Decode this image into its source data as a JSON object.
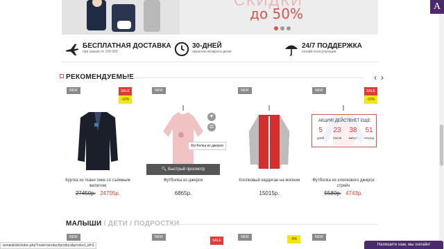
{
  "hero": {
    "headline_top": "СКИДКИ",
    "headline": "до 50%",
    "slide_count": 3,
    "active_slide": 1
  },
  "logo_letter": "A",
  "features": [
    {
      "icon": "airplane-icon",
      "title": "БЕСПЛАТНАЯ ДОСТАВКА",
      "subtitle": "при заказе от 100 000"
    },
    {
      "icon": "clock-icon",
      "title": "30-ДНЕЙ",
      "subtitle": "гарантия возврата денег"
    },
    {
      "icon": "umbrella-icon",
      "title": "24/7 ПОДДЕРЖКА",
      "subtitle": "онлайн консультации"
    }
  ],
  "recommended": {
    "title": "РЕКОМЕНДУЕМЫЕ",
    "products": [
      {
        "badge": "NEW",
        "sale": "SALE",
        "discount": "-10%",
        "name": "Куртка из ткани пике со съёмным жилетом",
        "old_price": "27450р.",
        "price": "24705р.",
        "image_icon": "jacket-icon"
      },
      {
        "badge": "NEW",
        "name": "Футболка из джерси",
        "price": "6865р.",
        "image_icon": "pink-shirt-icon"
      },
      {
        "badge": "NEW",
        "name": "Хлопковый кардиган на молнии",
        "price": "15015р.",
        "image_icon": "red-jacket-icon"
      },
      {
        "badge": "NEW",
        "sale": "SALE",
        "discount": "-15%",
        "name": "Футболка из хлопкового джерси стрейч",
        "old_price": "5580р.",
        "price": "4743р.",
        "image_icon": "blue-shirt-icon"
      }
    ],
    "quick_view": "Быстрый просмотр",
    "tooltip": "Футболка из джерси"
  },
  "countdown": {
    "title": "АКЦИЯ! ДЕЙСТВУЕТ ЕЩЕ:",
    "cells": [
      {
        "value": "5",
        "label": "дней"
      },
      {
        "value": "23",
        "label": "часов"
      },
      {
        "value": "38",
        "label": "минут"
      },
      {
        "value": "51",
        "label": "секунд"
      }
    ]
  },
  "section2": {
    "title_main": "МАЛЫШИ",
    "sep1": " / ",
    "tab2": "ДЕТИ",
    "sep2": " / ",
    "tab3": "ПОДРОСТКИ",
    "badges": [
      "NEW",
      "NEW",
      "NEW",
      "NEW"
    ],
    "sale": "SALE",
    "discount": "-5%"
  },
  "status_url": "armanikids/index.php?route=product/product&product_id=3",
  "chat_label": "Напишите нам, мы онлайн!"
}
